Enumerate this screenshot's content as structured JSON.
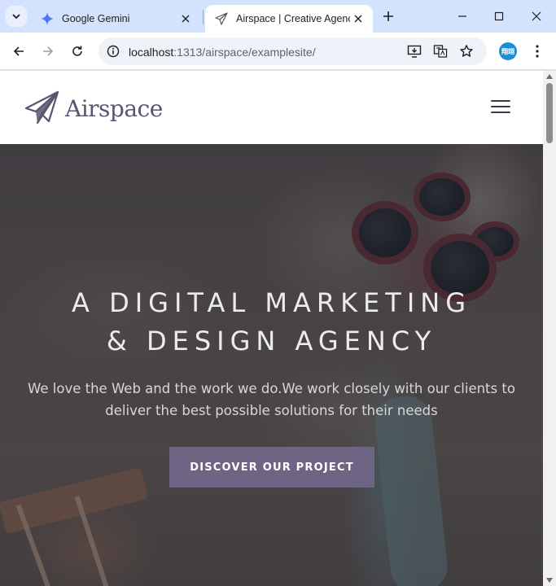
{
  "browser": {
    "tabs": [
      {
        "title": "Google Gemini",
        "icon": "gemini-icon",
        "active": false
      },
      {
        "title": "Airspace | Creative Agency",
        "icon": "paper-plane-icon",
        "active": true
      }
    ],
    "url_host": "localhost",
    "url_path": ":1313/airspace/examplesite/",
    "profile_initials": "翔翊",
    "accent_color": "#d3e3fd",
    "profile_color": "#1a8fd6"
  },
  "site": {
    "logo_text": "Airspace",
    "brand_color": "#5a5470",
    "hero": {
      "title_line1": "A DIGITAL MARKETING",
      "title_line2": "& DESIGN AGENCY",
      "subtitle": "We love the Web and the work we do.We work closely with our clients to deliver the best possible solutions for their needs",
      "cta_label": "DISCOVER OUR PROJECT",
      "cta_color": "#6e6584"
    }
  }
}
